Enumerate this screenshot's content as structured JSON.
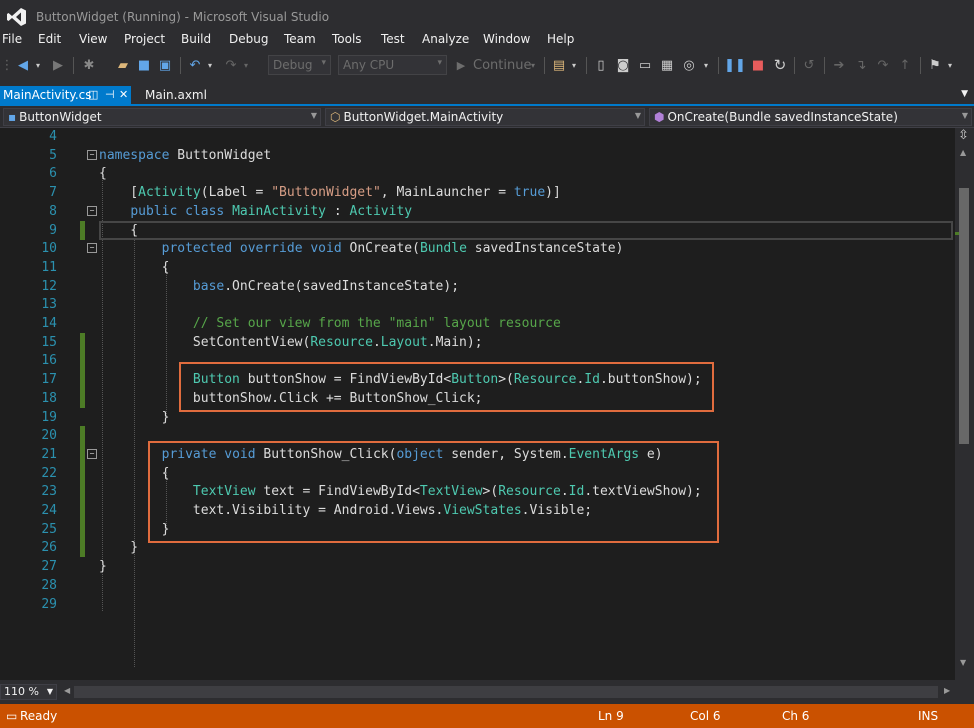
{
  "window": {
    "title": "ButtonWidget (Running) - Microsoft Visual Studio"
  },
  "menu": [
    "File",
    "Edit",
    "View",
    "Project",
    "Build",
    "Debug",
    "Team",
    "Tools",
    "Test",
    "Analyze",
    "Window",
    "Help"
  ],
  "toolbar": {
    "config": "Debug",
    "platform": "Any CPU",
    "continue": "Continue"
  },
  "tabs": [
    {
      "label": "MainActivity.cs",
      "active": true
    },
    {
      "label": "Main.axml",
      "active": false
    }
  ],
  "nav": {
    "project": "ButtonWidget",
    "class": "ButtonWidget.MainActivity",
    "member": "OnCreate(Bundle savedInstanceState)"
  },
  "lines": [
    {
      "num": "4",
      "code": []
    },
    {
      "num": "5",
      "code": [
        [
          "kw",
          "namespace"
        ],
        [
          "p",
          " ButtonWidget"
        ]
      ]
    },
    {
      "num": "6",
      "code": [
        [
          "p",
          "{"
        ]
      ]
    },
    {
      "num": "7",
      "code": [
        [
          "p",
          "    ["
        ],
        [
          "ty",
          "Activity"
        ],
        [
          "p",
          "(Label = "
        ],
        [
          "str",
          "\"ButtonWidget\""
        ],
        [
          "p",
          ", MainLauncher = "
        ],
        [
          "kw",
          "true"
        ],
        [
          "p",
          ")]"
        ]
      ]
    },
    {
      "num": "8",
      "code": [
        [
          "p",
          "    "
        ],
        [
          "kw",
          "public"
        ],
        [
          "p",
          " "
        ],
        [
          "kw",
          "class"
        ],
        [
          "p",
          " "
        ],
        [
          "ty",
          "MainActivity"
        ],
        [
          "p",
          " : "
        ],
        [
          "ty",
          "Activity"
        ]
      ]
    },
    {
      "num": "9",
      "code": [
        [
          "p",
          "    {"
        ]
      ]
    },
    {
      "num": "10",
      "code": [
        [
          "p",
          "        "
        ],
        [
          "kw",
          "protected"
        ],
        [
          "p",
          " "
        ],
        [
          "kw",
          "override"
        ],
        [
          "p",
          " "
        ],
        [
          "kw",
          "void"
        ],
        [
          "p",
          " OnCreate("
        ],
        [
          "ty",
          "Bundle"
        ],
        [
          "p",
          " savedInstanceState)"
        ]
      ]
    },
    {
      "num": "11",
      "code": [
        [
          "p",
          "        {"
        ]
      ]
    },
    {
      "num": "12",
      "code": [
        [
          "p",
          "            "
        ],
        [
          "kw",
          "base"
        ],
        [
          "p",
          ".OnCreate(savedInstanceState);"
        ]
      ]
    },
    {
      "num": "13",
      "code": []
    },
    {
      "num": "14",
      "code": [
        [
          "p",
          "            "
        ],
        [
          "cm",
          "// Set our view from the \"main\" layout resource"
        ]
      ]
    },
    {
      "num": "15",
      "code": [
        [
          "p",
          "            SetContentView("
        ],
        [
          "ty",
          "Resource"
        ],
        [
          "p",
          "."
        ],
        [
          "ty",
          "Layout"
        ],
        [
          "p",
          ".Main);"
        ]
      ]
    },
    {
      "num": "16",
      "code": []
    },
    {
      "num": "17",
      "code": [
        [
          "p",
          "            "
        ],
        [
          "ty",
          "Button"
        ],
        [
          "p",
          " buttonShow = FindViewById<"
        ],
        [
          "ty",
          "Button"
        ],
        [
          "p",
          ">("
        ],
        [
          "ty",
          "Resource"
        ],
        [
          "p",
          "."
        ],
        [
          "ty",
          "Id"
        ],
        [
          "p",
          ".buttonShow);"
        ]
      ]
    },
    {
      "num": "18",
      "code": [
        [
          "p",
          "            buttonShow.Click += ButtonShow_Click;"
        ]
      ]
    },
    {
      "num": "19",
      "code": [
        [
          "p",
          "        }"
        ]
      ]
    },
    {
      "num": "20",
      "code": []
    },
    {
      "num": "21",
      "code": [
        [
          "p",
          "        "
        ],
        [
          "kw",
          "private"
        ],
        [
          "p",
          " "
        ],
        [
          "kw",
          "void"
        ],
        [
          "p",
          " ButtonShow_Click("
        ],
        [
          "kw",
          "object"
        ],
        [
          "p",
          " sender, System."
        ],
        [
          "ty",
          "EventArgs"
        ],
        [
          "p",
          " e)"
        ]
      ]
    },
    {
      "num": "22",
      "code": [
        [
          "p",
          "        {"
        ]
      ]
    },
    {
      "num": "23",
      "code": [
        [
          "p",
          "            "
        ],
        [
          "ty",
          "TextView"
        ],
        [
          "p",
          " text = FindViewById<"
        ],
        [
          "ty",
          "TextView"
        ],
        [
          "p",
          ">("
        ],
        [
          "ty",
          "Resource"
        ],
        [
          "p",
          "."
        ],
        [
          "ty",
          "Id"
        ],
        [
          "p",
          ".textViewShow);"
        ]
      ]
    },
    {
      "num": "24",
      "code": [
        [
          "p",
          "            text.Visibility = Android.Views."
        ],
        [
          "ty",
          "ViewStates"
        ],
        [
          "p",
          ".Visible;"
        ]
      ]
    },
    {
      "num": "25",
      "code": [
        [
          "p",
          "        }"
        ]
      ]
    },
    {
      "num": "26",
      "code": [
        [
          "p",
          "    }"
        ]
      ]
    },
    {
      "num": "27",
      "code": [
        [
          "p",
          "}"
        ]
      ]
    },
    {
      "num": "28",
      "code": []
    },
    {
      "num": "29",
      "code": []
    }
  ],
  "zoom": "110 %",
  "status": {
    "state": "Ready",
    "ln": "Ln 9",
    "col": "Col 6",
    "ch": "Ch 6",
    "mode": "INS"
  },
  "colors": {
    "accent": "#007acc",
    "status": "#ca5100",
    "highlight": "#e06c3e"
  }
}
